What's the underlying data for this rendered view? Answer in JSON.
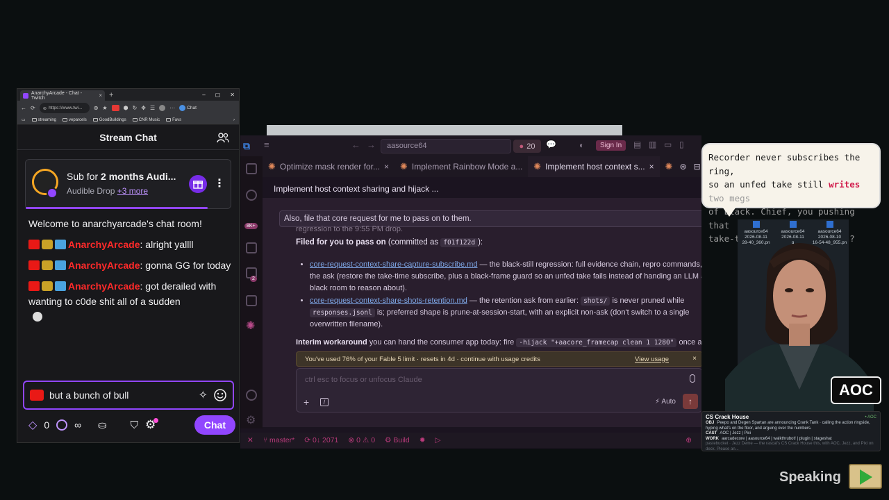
{
  "browser": {
    "tab_title": "AnarchyArcade - Chat - Twitch",
    "url": "https://www.twi...",
    "chat_ext_label": "Chat",
    "bookmarks": [
      "streaming",
      "veparcels",
      "GoodBuildings",
      "CNR Music",
      "Favs"
    ]
  },
  "chat": {
    "header": "Stream Chat",
    "sub_card": {
      "title_prefix": "Sub for ",
      "title_bold": "2 months Audi...",
      "subtitle": "Audible Drop ",
      "more_link": "+3 more"
    },
    "welcome": "Welcome to anarchyarcade's chat room!",
    "messages": [
      {
        "user": "AnarchyArcade",
        "text": ": alright yallll"
      },
      {
        "user": "AnarchyArcade",
        "text": ": gonna GG for today"
      },
      {
        "user": "AnarchyArcade",
        "text": ": got derailed with wanting to c0de shit all of a sudden"
      }
    ],
    "input_value": "but a bunch of bull",
    "points": "0",
    "infinity": "∞",
    "chat_button": "Chat",
    "colors": {
      "accent": "#9146ff",
      "username": "#ff2a2a"
    }
  },
  "vscode": {
    "search": "aasource64",
    "badge_count": "20",
    "sign_in": "Sign In",
    "activity_badges": [
      "8K+",
      "2"
    ],
    "tabs": [
      {
        "label": "Optimize mask render for..."
      },
      {
        "label": "Implement Rainbow Mode a..."
      },
      {
        "label": "Implement host context s..."
      }
    ],
    "panel_title": "Implement host context sharing and hijack ...",
    "quote": "Also, file that core request for me to pass on to them.",
    "ghost_line": "regression to the 9:55 PM drop.",
    "filed_bold": "Filed for you to pass on",
    "filed_rest": " (committed as ",
    "filed_commit": "f01f122d",
    "filed_end": "):",
    "bullet1_link": "core-request-context-share-capture-subscribe.md",
    "bullet1_text": " — the black-still regression: full evidence chain, repro commands, and the ask (restore the take-time subscribe, plus a black-frame guard so an unfed take fails instead of handing an LLM a black room to reason about).",
    "bullet2_link": "core-request-context-share-shots-retention.md",
    "bullet2_text1": " — the retention ask from earlier: ",
    "bullet2_code1": "shots/",
    "bullet2_text2": " is never pruned while ",
    "bullet2_code2": "responses.jsonl",
    "bullet2_text3": " is; preferred shape is prune-at-session-start, with an explicit non-ask (don't switch to a single overwritten filename).",
    "interim_bold": "Interim workaround",
    "interim_text": " you can hand the consumer app today: fire ",
    "interim_code": "-hijack \"+aacore_framecap clean 1 1280\"",
    "interim_end": " once after",
    "usage_text": "You've used 76% of your Fable 5 limit · resets in 4d · continue with usage credits",
    "usage_link": "View usage",
    "input_placeholder": "ctrl esc to focus or unfocus Claude",
    "auto_label": "Auto",
    "status": {
      "branch": "master*",
      "sync": "0↓ 2071",
      "errors": "0",
      "warnings": "0",
      "build": "Build"
    }
  },
  "overlay": {
    "bubble": {
      "l1": "Recorder never subscribes the ring,",
      "l2a": "so an unfed take still ",
      "l2hl": "writes",
      "l2b": " two megs",
      "l3": "of black. Chief, you pushing that",
      "l4": "take-time subscribe back in?"
    },
    "files": [
      {
        "name": "aasource64",
        "date": "2026-08-11",
        "time": "28-40_360.pn"
      },
      {
        "name": "aasource64",
        "date": "2026-08-11",
        "time": "g"
      },
      {
        "name": "aasource64",
        "date": "2026-08-10",
        "time": "16-54-48_955.pn"
      }
    ],
    "aoc_badge": "AOC",
    "cs_panel": {
      "title": "CS Crack House",
      "aoc": "• AOC",
      "obj_label": "OBJ",
      "obj": "Peepo and Degen Spartan are announcing Crank Tank · calling the action ringside, hyping what's on the floor, and arguing over the numbers.",
      "cast_label": "CAST",
      "cast": "AOC | Jezz | Pixi",
      "work_label": "WORK",
      "work": "aarcadecore | aasource64 | walkthrubot! | plugin | stageshat",
      "extra": "pastebucket · Jezz Deme — the rascal's CS Crack House this, with AOC, Jezz, and Pixi on deck. Please an..."
    },
    "speaking": "Speaking"
  }
}
